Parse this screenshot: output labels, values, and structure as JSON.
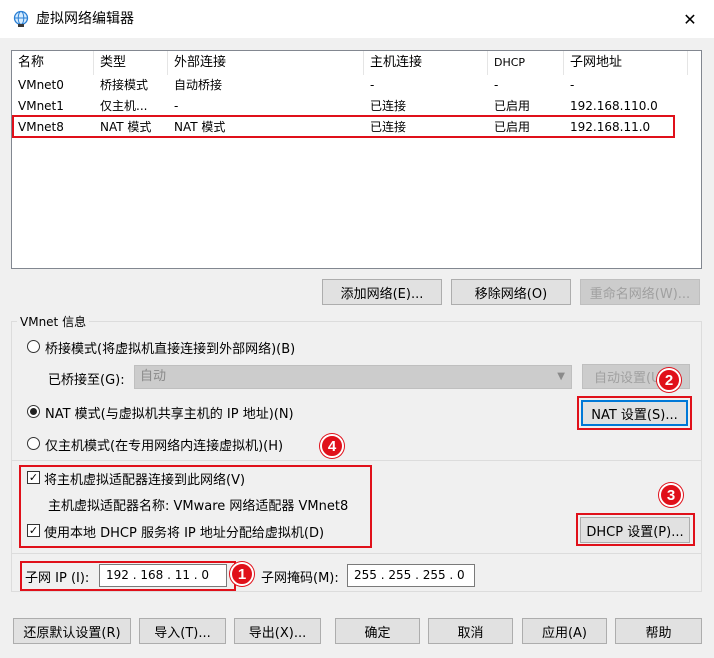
{
  "window": {
    "title": "虚拟网络编辑器",
    "icon": "globe-network-icon",
    "close_glyph": "✕"
  },
  "network_list": {
    "columns": [
      "名称",
      "类型",
      "外部连接",
      "主机连接",
      "DHCP",
      "子网地址"
    ],
    "rows": [
      [
        "VMnet0",
        "桥接模式",
        "自动桥接",
        "-",
        "-",
        "-"
      ],
      [
        "VMnet1",
        "仅主机...",
        "-",
        "已连接",
        "已启用",
        "192.168.110.0"
      ],
      [
        "VMnet8",
        "NAT 模式",
        "NAT 模式",
        "已连接",
        "已启用",
        "192.168.11.0"
      ]
    ],
    "selected_index": 2
  },
  "list_buttons": {
    "add": "添加网络(E)...",
    "remove": "移除网络(O)",
    "rename": "重命名网络(W)..."
  },
  "vmnet_info": {
    "group_label": "VMnet 信息",
    "bridged_radio": "桥接模式(将虚拟机直接连接到外部网络)(B)",
    "bridged_to_label": "已桥接至(G):",
    "bridged_to_value": "自动",
    "auto_settings": "自动设置(U)...",
    "nat_radio": "NAT 模式(与虚拟机共享主机的 IP 地址)(N)",
    "nat_settings": "NAT 设置(S)...",
    "hostonly_radio": "仅主机模式(在专用网络内连接虚拟机)(H)",
    "connect_adapter_check": "将主机虚拟适配器连接到此网络(V)",
    "adapter_name_text": "主机虚拟适配器名称: VMware 网络适配器 VMnet8",
    "dhcp_check": "使用本地 DHCP 服务将 IP 地址分配给虚拟机(D)",
    "dhcp_settings": "DHCP 设置(P)...",
    "subnet_ip_label": "子网 IP (I):",
    "subnet_ip": "192 . 168 . 11 . 0",
    "subnet_mask_label": "子网掩码(M):",
    "subnet_mask": "255 . 255 . 255 . 0",
    "check_glyph": "✓"
  },
  "bottom_buttons": {
    "restore": "还原默认设置(R)",
    "import": "导入(T)...",
    "export": "导出(X)...",
    "ok": "确定",
    "cancel": "取消",
    "apply": "应用(A)",
    "help": "帮助"
  },
  "callouts": {
    "one": "1",
    "two": "2",
    "three": "3",
    "four": "4",
    "color": "#e0101a"
  }
}
